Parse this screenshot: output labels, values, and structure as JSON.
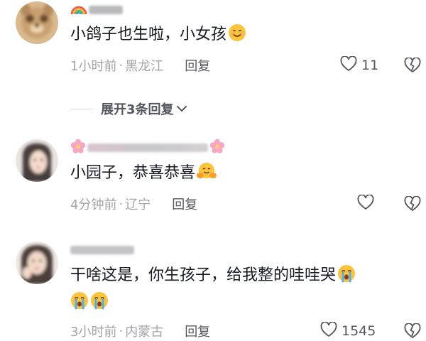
{
  "comments": [
    {
      "username_icon": "rainbow-icon",
      "text": "小鸽子也生啦，小女孩",
      "emoji": "smiling-face-emoji",
      "time": "1小时前",
      "separator": "·",
      "location": "黑龙江",
      "reply_label": "回复",
      "like_count": "11"
    },
    {
      "username_icon": "cherry-blossom-icon",
      "text": "小园子，恭喜恭喜",
      "emoji": "hugging-face-emoji",
      "time": "4分钟前",
      "separator": "·",
      "location": "辽宁",
      "reply_label": "回复",
      "like_count": ""
    },
    {
      "username_icon": "",
      "text_line1": "干啥这是，你生孩子，给我整的哇哇哭",
      "emoji": "crying-face-emoji",
      "time": "3小时前",
      "separator": "·",
      "location": "内蒙古",
      "reply_label": "回复",
      "like_count": "1545"
    }
  ],
  "expand_replies": {
    "label": "展开3条回复"
  },
  "colors": {
    "text": "#161823",
    "meta": "#a3a4a9",
    "action": "#555660",
    "divider": "#d9d9dc",
    "emoji_yellow": "#fcc33c",
    "tears_blue": "#4ab0f2"
  }
}
